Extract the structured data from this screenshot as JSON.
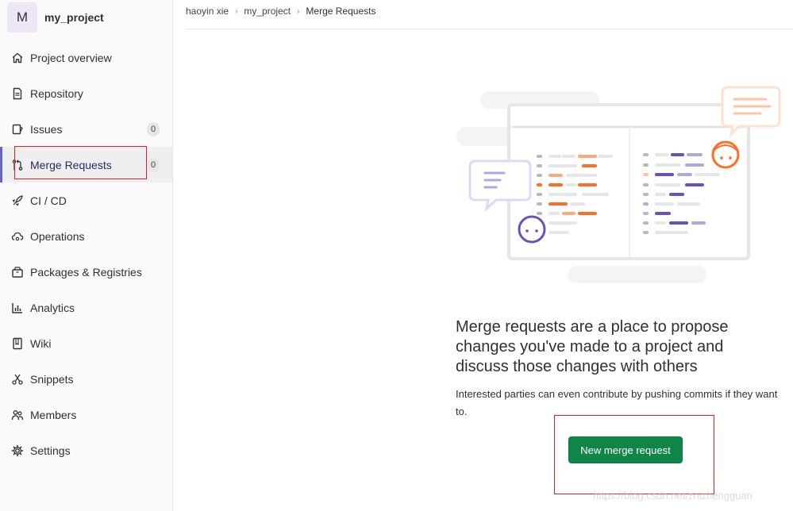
{
  "project": {
    "avatar_letter": "M",
    "name": "my_project"
  },
  "sidebar": {
    "items": [
      {
        "label": "Project overview",
        "icon": "home-icon"
      },
      {
        "label": "Repository",
        "icon": "document-icon"
      },
      {
        "label": "Issues",
        "icon": "issues-icon",
        "badge": "0"
      },
      {
        "label": "Merge Requests",
        "icon": "git-merge-icon",
        "badge": "0",
        "active": true
      },
      {
        "label": "CI / CD",
        "icon": "rocket-icon"
      },
      {
        "label": "Operations",
        "icon": "cloud-gear-icon"
      },
      {
        "label": "Packages & Registries",
        "icon": "package-icon"
      },
      {
        "label": "Analytics",
        "icon": "chart-icon"
      },
      {
        "label": "Wiki",
        "icon": "book-icon"
      },
      {
        "label": "Snippets",
        "icon": "scissors-icon"
      },
      {
        "label": "Members",
        "icon": "users-icon"
      },
      {
        "label": "Settings",
        "icon": "settings-icon"
      }
    ]
  },
  "breadcrumb": {
    "user": "haoyin xie",
    "project": "my_project",
    "current": "Merge Requests"
  },
  "empty_state": {
    "title": "Merge requests are a place to propose changes you've made to a project and discuss those changes with others",
    "description": "Interested parties can even contribute by pushing commits if they want to.",
    "button_label": "New merge request"
  },
  "watermark": "https://blog.csdn.net/zhizhengguan",
  "colors": {
    "accent": "#6666c4",
    "button_green": "#108548",
    "highlight_red": "#e02020",
    "illustration_orange": "#fc6d26",
    "illustration_purple": "#6b4fbb"
  }
}
